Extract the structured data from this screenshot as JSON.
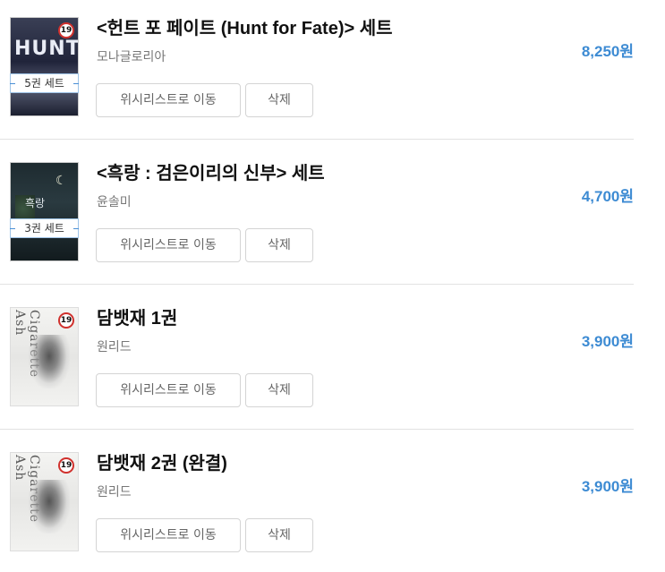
{
  "items": [
    {
      "title": "<헌트 포 페이트 (Hunt for Fate)> 세트",
      "author": "모나글로리아",
      "price": "8,250원",
      "badge": "5권 세트",
      "cover_text": "HUNT",
      "age": "19"
    },
    {
      "title": "<흑랑 : 검은이리의 신부> 세트",
      "author": "윤솔미",
      "price": "4,700원",
      "badge": "3권 세트",
      "cover_text": "흑랑",
      "age": ""
    },
    {
      "title": "담뱃재 1권",
      "author": "원리드",
      "price": "3,900원",
      "badge": "",
      "cover_text": "Cigarette Ash",
      "age": "19"
    },
    {
      "title": "담뱃재 2권 (완결)",
      "author": "원리드",
      "price": "3,900원",
      "badge": "",
      "cover_text": "Cigarette Ash",
      "age": "19"
    }
  ],
  "buttons": {
    "wishlist": "위시리스트로 이동",
    "delete": "삭제"
  },
  "colors": {
    "price": "#3d8bd3",
    "badge_border": "#9ec4e8",
    "age_ring": "#d0312d"
  }
}
